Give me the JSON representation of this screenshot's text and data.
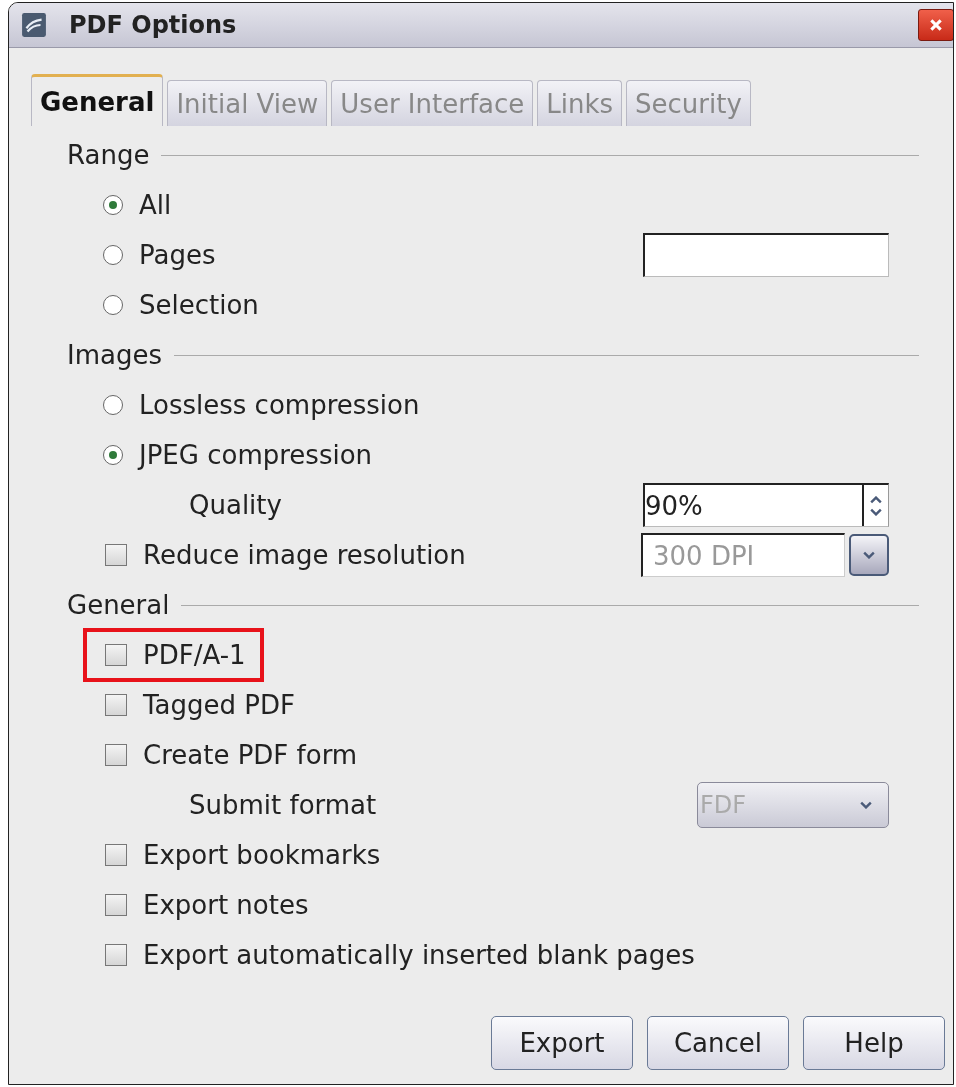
{
  "window": {
    "title": "PDF Options"
  },
  "tabs": [
    {
      "label": "General",
      "selected": true
    },
    {
      "label": "Initial View",
      "selected": false
    },
    {
      "label": "User Interface",
      "selected": false
    },
    {
      "label": "Links",
      "selected": false
    },
    {
      "label": "Security",
      "selected": false
    }
  ],
  "sections": [
    {
      "title": "Range",
      "items": [
        {
          "kind": "radio",
          "label": "All",
          "selected": true
        },
        {
          "kind": "radio",
          "label": "Pages",
          "selected": false,
          "control": {
            "kind": "field",
            "disabled": false
          }
        },
        {
          "kind": "radio",
          "label": "Selection",
          "selected": false
        }
      ]
    },
    {
      "title": "Images",
      "items": [
        {
          "kind": "radio",
          "label": "Lossless compression",
          "selected": false
        },
        {
          "kind": "radio",
          "label": "JPEG compression",
          "selected": true,
          "children": [
            {
              "kind": "label",
              "label": "Quality",
              "control": {
                "kind": "spin",
                "value": "90%",
                "disabled": false
              }
            }
          ]
        },
        {
          "kind": "checkbox",
          "label": "Reduce image resolution",
          "checked": false,
          "control": {
            "kind": "combo",
            "value": "300 DPI",
            "disabled": true
          }
        }
      ]
    },
    {
      "title": "General",
      "items": [
        {
          "kind": "checkbox",
          "label": "PDF/A-1",
          "checked": false,
          "highlighted": true
        },
        {
          "kind": "checkbox",
          "label": "Tagged PDF",
          "checked": false,
          "highlighted": false
        },
        {
          "kind": "checkbox",
          "label": "Create PDF form",
          "checked": false,
          "highlighted": false,
          "children": [
            {
              "kind": "label",
              "label": "Submit format",
              "control": {
                "kind": "dropdown",
                "value": "FDF",
                "disabled": true
              }
            }
          ]
        },
        {
          "kind": "checkbox",
          "label": "Export bookmarks",
          "checked": false,
          "highlighted": false
        },
        {
          "kind": "checkbox",
          "label": "Export notes",
          "checked": false,
          "highlighted": false
        },
        {
          "kind": "checkbox",
          "label": "Export automatically inserted blank pages",
          "checked": false,
          "highlighted": false
        }
      ]
    }
  ],
  "buttons": [
    {
      "label": "Export"
    },
    {
      "label": "Cancel"
    },
    {
      "label": "Help"
    }
  ]
}
